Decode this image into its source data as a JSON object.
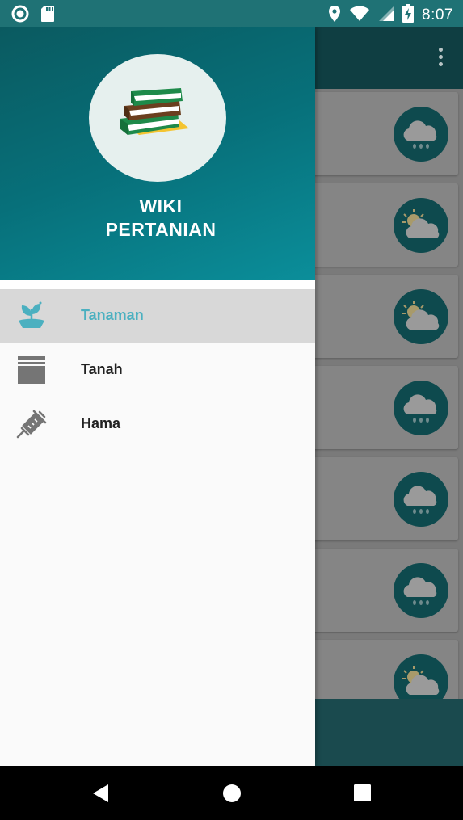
{
  "status_bar": {
    "time": "8:07",
    "left_icons": [
      "record-icon",
      "sd-card-icon"
    ],
    "right_icons": [
      "location-icon",
      "wifi-icon",
      "cell-signal-icon",
      "battery-charging-icon"
    ]
  },
  "drawer": {
    "app_title_line1": "WIKI",
    "app_title_line2": "PERTANIAN",
    "logo_icon": "books-icon",
    "items": [
      {
        "label": "Tanaman",
        "icon": "plant-icon",
        "selected": true
      },
      {
        "label": "Tanah",
        "icon": "soil-layers-icon",
        "selected": false
      },
      {
        "label": "Hama",
        "icon": "syringe-icon",
        "selected": false
      }
    ]
  },
  "background": {
    "card_icons": [
      "rain-cloud-icon",
      "sun-cloud-icon",
      "sun-cloud-icon",
      "rain-cloud-icon",
      "rain-cloud-icon",
      "rain-cloud-icon",
      "sun-cloud-icon"
    ]
  },
  "colors": {
    "accent": "#4bb0c0",
    "header_start": "#0a5a60",
    "header_end": "#0b8e9a",
    "status_bar": "#1f7275"
  }
}
